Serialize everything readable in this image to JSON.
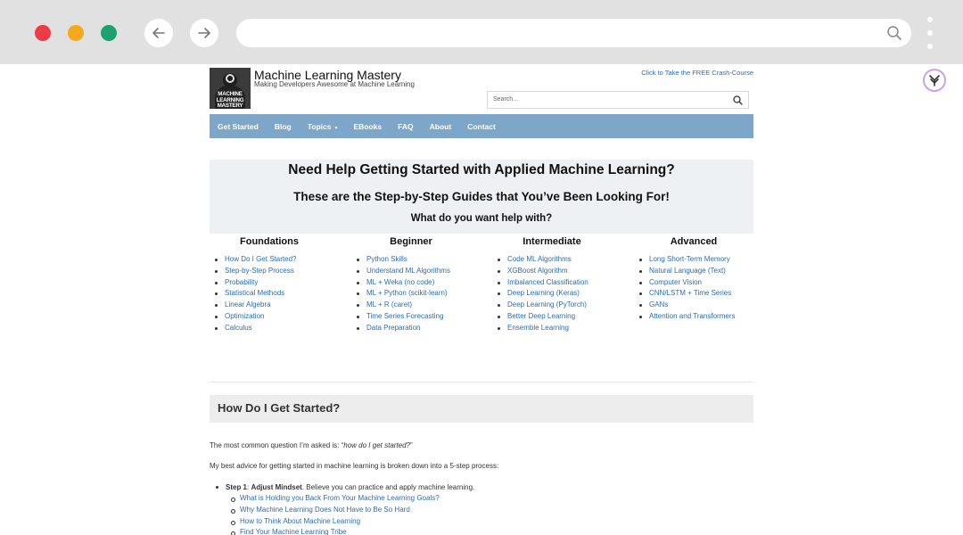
{
  "browser": {
    "url": "",
    "icons": {
      "back": "arrow-left-icon",
      "forward": "arrow-right-icon",
      "search": "search-icon",
      "menu": "more-vertical-icon"
    }
  },
  "header": {
    "logo_text": "MACHINE LEARNING MASTERY",
    "title": "Machine Learning Mastery",
    "tagline": "Making Developers Awesome at Machine Learning",
    "crash_course_link": "Click to Take the FREE Crash-Course",
    "search_placeholder": "Search..."
  },
  "nav": {
    "items": [
      "Get Started",
      "Blog",
      "Topics",
      "EBooks",
      "FAQ",
      "About",
      "Contact"
    ],
    "topics_caret": "▾"
  },
  "hero": {
    "title": "Need Help Getting Started with Applied Machine Learning?",
    "subtitle": "These are the Step-by-Step Guides that You’ve Been Looking For!",
    "question": "What do you want help with?"
  },
  "columns": [
    {
      "heading": "Foundations",
      "links": [
        "How Do I Get Started?",
        "Step-by-Step Process",
        "Probability",
        "Statistical Methods",
        "Linear Algebra",
        "Optimization",
        "Calculus"
      ]
    },
    {
      "heading": "Beginner",
      "links": [
        "Python Skills",
        "Understand ML Algorithms",
        "ML + Weka (no code)",
        "ML + Python (scikit-learn)",
        "ML + R (caret)",
        "Time Series Forecasting",
        "Data Preparation"
      ]
    },
    {
      "heading": "Intermediate",
      "links": [
        "Code ML Algorithms",
        "XGBoost Algorithm",
        "Imbalanced Classification",
        "Deep Learning (Keras)",
        "Deep Learning (PyTorch)",
        "Better Deep Learning",
        "Ensemble Learning"
      ]
    },
    {
      "heading": "Advanced",
      "links": [
        "Long Short-Term Memory",
        "Natural Language (Text)",
        "Computer Vision",
        "CNN/LSTM + Time Series",
        "GANs",
        "Attention and Transformers"
      ]
    }
  ],
  "section": {
    "heading": "How Do I Get Started?",
    "p1_prefix": "The most common question I’m asked is: “",
    "p1_quote": "how do I get started?",
    "p1_suffix": "”",
    "p2": "My best advice for getting started in machine learning is broken down into a 5-step process:",
    "step_label": "Step 1",
    "step_sep": ": ",
    "step_title": "Adjust Mindset",
    "step_text": ". Believe you can practice and apply machine learning.",
    "step_links": [
      "What is Holding you Back From Your Machine Learning Goals?",
      "Why Machine Learning Does Not Have to Be So Hard",
      "How to Think About Machine Learning",
      "Find Your Machine Learning Tribe"
    ]
  },
  "colors": {
    "nav_bg": "#7ea6c8",
    "link": "#2b6cb8",
    "hero_bg": "#edf1f4",
    "chrome_bg": "#e1e1e1"
  }
}
